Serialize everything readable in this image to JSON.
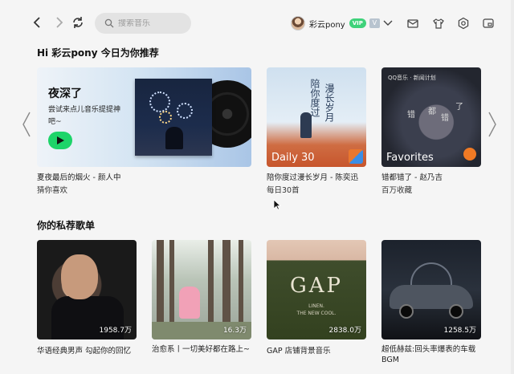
{
  "search": {
    "placeholder": "搜索音乐"
  },
  "user": {
    "name": "彩云pony",
    "vip_badge": "VIP",
    "vip2_badge": "V"
  },
  "recommend": {
    "title": "Hi 彩云pony 今日为你推荐",
    "banner": {
      "title": "夜深了",
      "subtitle": "尝试来点儿音乐提提神吧~"
    },
    "cards": [
      {
        "line1": "夏夜最后的烟火 - 颜人中",
        "line2": "猜你喜欢"
      },
      {
        "line1": "陪你度过漫长岁月 - 陈奕迅",
        "line2": "每日30首",
        "cover_text": "Daily 30",
        "vertical_left": "陪你度过",
        "vertical_right": "漫长岁月"
      },
      {
        "line1": "错都错了 - 赵乃吉",
        "line2": "百万收藏",
        "cover_text": "Favorites",
        "cover_brand": "QQ音乐 · 新闻计划",
        "words": [
          "错",
          "都",
          "错",
          "了"
        ]
      }
    ]
  },
  "playlists": {
    "title": "你的私荐歌单",
    "items": [
      {
        "title": "华语经典男声 勾起你的回忆",
        "count": "1958.7万"
      },
      {
        "title": "治愈系丨一切美好都在路上~",
        "count": "16.3万"
      },
      {
        "title": "GAP 店铺背景音乐",
        "count": "2838.0万",
        "cover_brand": "GAP",
        "cover_sub": "LINEN.\nTHE NEW COOL."
      },
      {
        "title": "超低赫兹:回头率爆表的车载BGM",
        "count": "1258.5万"
      }
    ]
  }
}
